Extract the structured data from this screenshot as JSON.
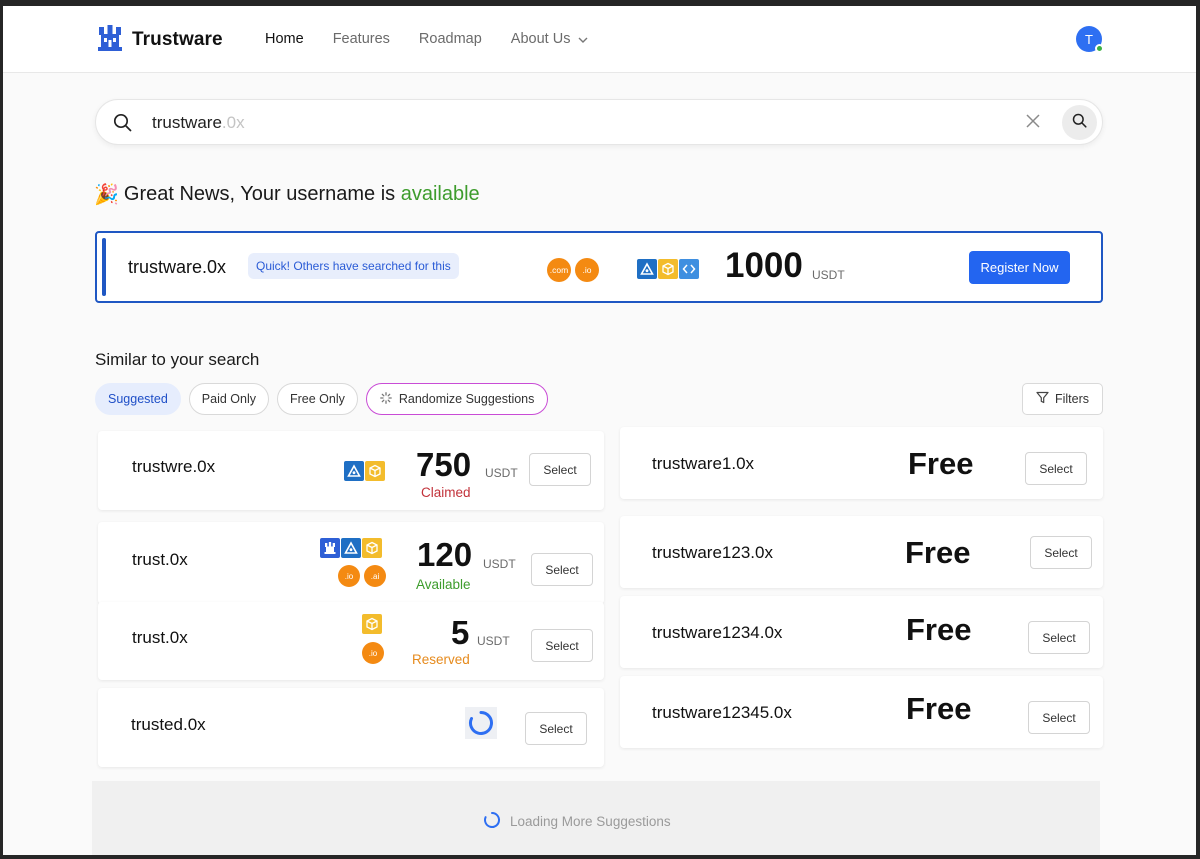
{
  "brand": {
    "name": "Trustware"
  },
  "nav": [
    {
      "label": "Home",
      "active": true
    },
    {
      "label": "Features",
      "active": false
    },
    {
      "label": "Roadmap",
      "active": false
    },
    {
      "label": "About Us",
      "active": false,
      "dropdown": true
    }
  ],
  "user": {
    "initial": "T",
    "online": true
  },
  "search": {
    "typed": "trustware",
    "suffix": ".0x"
  },
  "headline": {
    "prefix": "Great News, Your username is ",
    "status": "available",
    "emoji": "🎉"
  },
  "result": {
    "name": "trustware.0x",
    "hint": "Quick! Others have searched for this",
    "tlds": [
      ".com",
      ".io"
    ],
    "chains": [
      "blue-triangle",
      "gold-box",
      "code-brackets"
    ],
    "price": "1000",
    "unit": "USDT",
    "register_label": "Register Now"
  },
  "similar": {
    "title": "Similar to your search",
    "filters": [
      "Suggested",
      "Paid Only",
      "Free Only",
      "Randomize Suggestions"
    ],
    "active_filter": "Suggested",
    "filters_button": "Filters"
  },
  "suggestions_left": [
    {
      "name": "trustwre.0x",
      "chains": [
        "blue-triangle",
        "gold-box"
      ],
      "tlds": [],
      "price": "750",
      "unit": "USDT",
      "status": "Claimed",
      "select": "Select"
    },
    {
      "name": "trust.0x",
      "chains": [
        "castle",
        "blue-triangle",
        "gold-box"
      ],
      "tlds": [
        ".io",
        ".ai"
      ],
      "price": "120",
      "unit": "USDT",
      "status": "Available",
      "select": "Select"
    },
    {
      "name": "trust.0x",
      "chains": [
        "gold-box"
      ],
      "tlds": [
        ".io"
      ],
      "price": "5",
      "unit": "USDT",
      "status": "Reserved",
      "select": "Select"
    },
    {
      "name": "trusted.0x",
      "loading": true,
      "select": "Select"
    }
  ],
  "suggestions_right": [
    {
      "name": "trustware1.0x",
      "price": "Free",
      "select": "Select"
    },
    {
      "name": "trustware123.0x",
      "price": "Free",
      "select": "Select"
    },
    {
      "name": "trustware1234.0x",
      "price": "Free",
      "select": "Select"
    },
    {
      "name": "trustware12345.0x",
      "price": "Free",
      "select": "Select"
    }
  ],
  "loading_more": "Loading More Suggestions",
  "colors": {
    "primary": "#2365f0",
    "available": "#3d9c2c",
    "claimed": "#c2323a",
    "reserved": "#e68a1c",
    "tld_orange": "#f48a12"
  }
}
